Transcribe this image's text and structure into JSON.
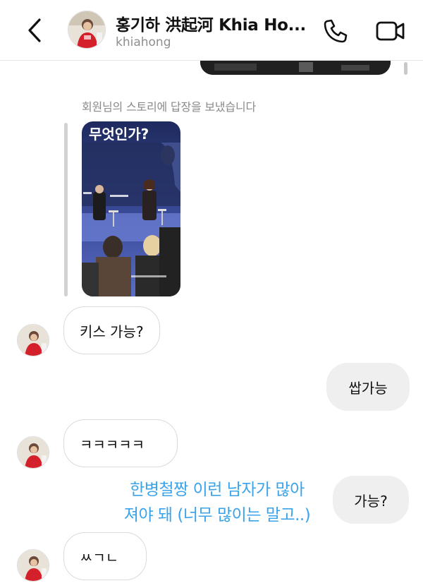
{
  "header": {
    "title": "홍기하 洪起河 Khia Ho...",
    "username": "khiahong",
    "back_icon": "chevron-left-icon",
    "call_icon": "phone-icon",
    "video_icon": "video-camera-icon"
  },
  "story_reply": {
    "note": "회원님의 스토리에 답장을 보냈습니다",
    "image_caption": "무엇인가?"
  },
  "messages": [
    {
      "direction": "incoming",
      "text": "키스 가능?"
    },
    {
      "direction": "outgoing",
      "text": "쌉가능"
    },
    {
      "direction": "incoming",
      "text": "ㅋㅋㅋㅋㅋ"
    },
    {
      "direction": "outgoing",
      "text": "가능?"
    },
    {
      "direction": "incoming",
      "text": "ㅆㄱㄴ"
    }
  ],
  "overlay_caption": {
    "line1": "한병철짱 이런 남자가 많아",
    "line2": "져야 돼 (너무 많이는 말고..)"
  },
  "colors": {
    "overlay_text": "#3ba3e9",
    "outgoing_bubble": "#efefef",
    "incoming_border": "#dbdbdb"
  }
}
